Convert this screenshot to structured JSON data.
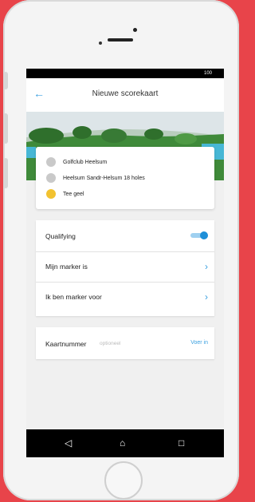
{
  "status_bar": {
    "time": "100"
  },
  "app_bar": {
    "back_icon": "arrow-left-icon",
    "title": "Nieuwe scorekaart"
  },
  "course_card": {
    "rows": [
      {
        "icon": "club-icon",
        "color": "#c9c9c9",
        "text": "Golfclub Heelsum"
      },
      {
        "icon": "course-icon",
        "color": "#c9c9c9",
        "text": "Heelsum Sandr-Helsum 18 holes"
      },
      {
        "icon": "tee-icon",
        "color": "#f2c230",
        "text": "Tee geel"
      }
    ]
  },
  "settings": {
    "qualifying": {
      "label": "Qualifying",
      "enabled": true
    },
    "my_marker": {
      "label": "Mijn marker is"
    },
    "marker_for": {
      "label": "Ik ben marker voor"
    }
  },
  "card_number": {
    "label": "Kaartnummer",
    "placeholder": "optioneel",
    "action": "Voer in"
  },
  "nav": {
    "back": "◁",
    "home": "⌂",
    "recent": "□"
  },
  "colors": {
    "background": "#e8444a",
    "accent": "#3aa0e0",
    "toggle": "#1e8fd8"
  }
}
